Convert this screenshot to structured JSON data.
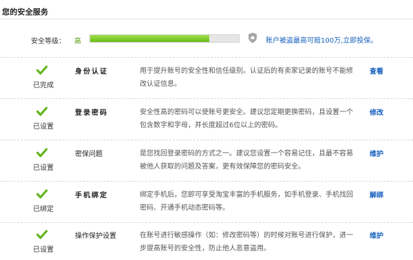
{
  "section_title": "您的安全服务",
  "security_level": {
    "label": "安全等级：",
    "value": "高",
    "progress_fraction": 0.8,
    "colors": {
      "fill": "#68bc14",
      "value_text": "#4a9a06"
    },
    "shield_icon": "shield-icon",
    "promo_link": "账户被盗最高可赔100万,立即投保。"
  },
  "items": [
    {
      "status": "已完成",
      "name": "身份认证",
      "description": "用于提升账号的安全性和信任级别。认证后的有卖家记录的账号不能修改认证信息。",
      "action": "查看",
      "icon": "check-icon"
    },
    {
      "status": "已设置",
      "name": "登录密码",
      "description": "安全性高的密码可以使账号更安全。建议您定期更换密码，且设置一个包含数字和字母，并长度超过6位以上的密码。",
      "action": "修改",
      "icon": "check-icon"
    },
    {
      "status": "已设置",
      "name": "密保问题",
      "description": "是您找回登录密码的方式之一。建议您设置一个容易记住，且最不容易被他人获取的问题及答案，更有效保障您的密码安全。",
      "action": "维护",
      "icon": "check-icon"
    },
    {
      "status": "已绑定",
      "name": "手机绑定",
      "description": "绑定手机后，您即可享受淘宝丰富的手机服务，如手机登录、手机找回密码、开通手机动态密码等。",
      "action": "解绑",
      "icon": "check-icon"
    },
    {
      "status": "已设置",
      "name": "操作保护设置",
      "description": "在账号进行敏感操作（如：修改密码等）的时候对账号进行保护，进一步提高账号的安全性，防止他人恶意盗用。",
      "action": "维护",
      "icon": "check-icon"
    }
  ]
}
